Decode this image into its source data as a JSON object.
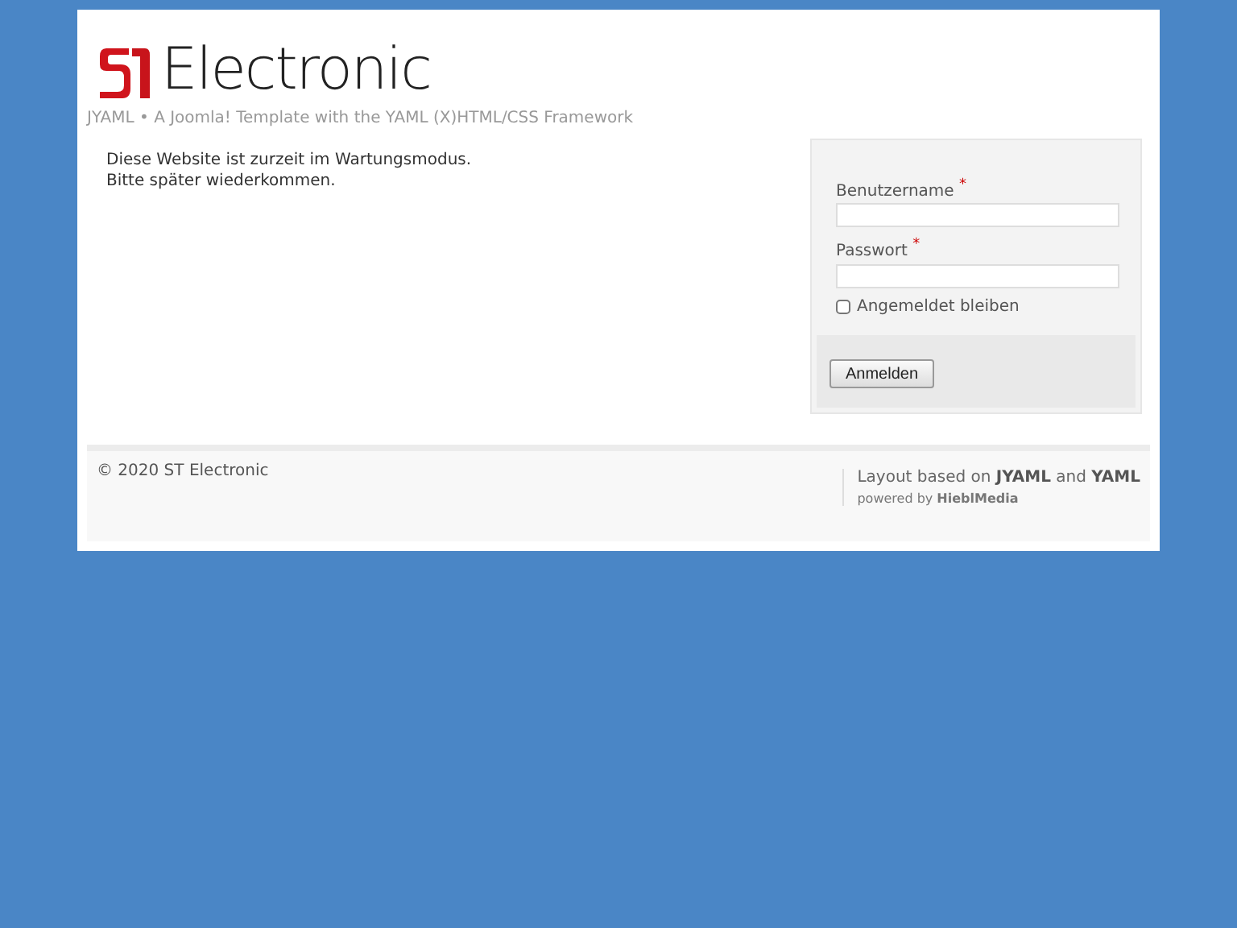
{
  "header": {
    "logo_text": "Electronic",
    "tagline": "JYAML • A Joomla! Template with the YAML (X)HTML/CSS Framework"
  },
  "message": [
    "Diese Website ist zurzeit im Wartungsmodus.",
    "Bitte später wiederkommen."
  ],
  "login": {
    "fields": [
      {
        "label": "Benutzername",
        "required_mark": "*"
      },
      {
        "label": "Passwort",
        "required_mark": "*"
      }
    ],
    "remember": {
      "label": "Angemeldet bleiben",
      "checked": false
    },
    "button": "Anmelden"
  },
  "footer": {
    "copyright": "© 2020 ST Electronic",
    "credit": "Layout based on **JYAML** and **YAML**",
    "powered": "powered by **HieblMedia**"
  }
}
